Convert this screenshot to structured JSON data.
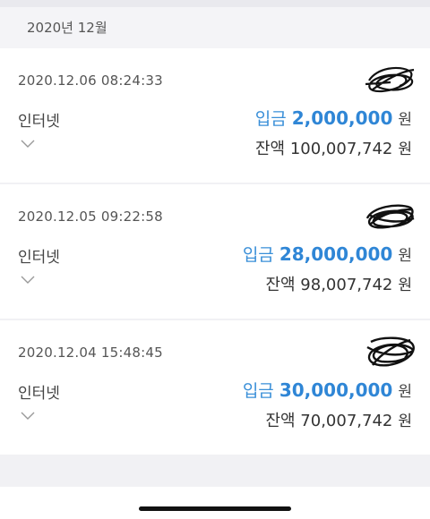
{
  "header": {
    "month": "2020년 12월"
  },
  "transactions": [
    {
      "datetime": "2020.12.06  08:24:33",
      "kind": "인터넷",
      "deposit_label": "입금",
      "deposit_amount": "2,000,000",
      "currency": "원",
      "balance_label": "잔액",
      "balance_amount": "100,007,742"
    },
    {
      "datetime": "2020.12.05  09:22:58",
      "kind": "인터넷",
      "deposit_label": "입금",
      "deposit_amount": "28,000,000",
      "currency": "원",
      "balance_label": "잔액",
      "balance_amount": "98,007,742"
    },
    {
      "datetime": "2020.12.04  15:48:45",
      "kind": "인터넷",
      "deposit_label": "입금",
      "deposit_amount": "30,000,000",
      "currency": "원",
      "balance_label": "잔액",
      "balance_amount": "70,007,742"
    }
  ],
  "colors": {
    "accent": "#2f86d6",
    "background": "#f1f1f4",
    "card": "#ffffff"
  },
  "icons": {
    "expand": "chevron-down-icon",
    "redaction": "redaction-scribble"
  }
}
